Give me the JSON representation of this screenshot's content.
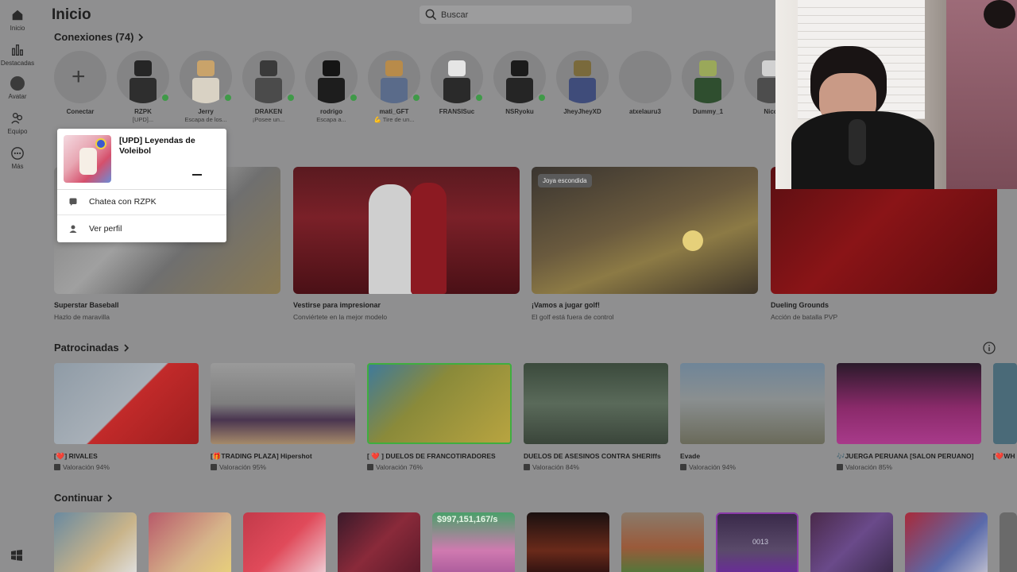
{
  "sidebar": {
    "items": [
      {
        "label": "Inicio",
        "icon": "home-icon"
      },
      {
        "label": "Destacadas",
        "icon": "chart-icon"
      },
      {
        "label": "Avatar",
        "icon": "avatar-icon"
      },
      {
        "label": "Equipo",
        "icon": "team-icon"
      },
      {
        "label": "Más",
        "icon": "more-icon"
      }
    ],
    "bottom_icon": "windows-icon"
  },
  "header": {
    "title": "Inicio",
    "search_placeholder": "Buscar"
  },
  "connections": {
    "title": "Conexiones (74)",
    "items": [
      {
        "name": "Conectar",
        "status": "",
        "online": false
      },
      {
        "name": "RZPK",
        "status": "[UPD]...",
        "online": true
      },
      {
        "name": "Jerry",
        "status": "Escapa de los...",
        "online": true
      },
      {
        "name": "DRAKEN",
        "status": "¡Posee un...",
        "online": true
      },
      {
        "name": "rodrigo",
        "status": "Escapa a...",
        "online": true
      },
      {
        "name": "mati_GFT",
        "status": "💪 Tire de un...",
        "online": true
      },
      {
        "name": "FRANSISuc",
        "status": "",
        "online": false
      },
      {
        "name": "NSRyoku",
        "status": "",
        "online": true
      },
      {
        "name": "JheyJheyXD",
        "status": "",
        "online": false
      },
      {
        "name": "atxelauru3",
        "status": "",
        "online": false
      },
      {
        "name": "Dummy_1",
        "status": "",
        "online": false
      },
      {
        "name": "Nico",
        "status": "",
        "online": false
      }
    ]
  },
  "popup": {
    "game_title": "[UPD] Leyendas de Voleibol",
    "chat_label": "Chatea con RZPK",
    "profile_label": "Ver perfil"
  },
  "recommended": {
    "games": [
      {
        "title": "Superstar Baseball",
        "subtitle": "Hazlo de maravilla",
        "badge": ""
      },
      {
        "title": "Vestirse para impresionar",
        "subtitle": "Conviértete en la mejor modelo",
        "badge": ""
      },
      {
        "title": "¡Vamos a jugar golf!",
        "subtitle": "El golf está fuera de control",
        "badge": "Joya escondida"
      },
      {
        "title": "Dueling Grounds",
        "subtitle": "Acción de batalla PVP",
        "badge": ""
      }
    ]
  },
  "sponsored": {
    "title": "Patrocinadas",
    "games": [
      {
        "title": "[❤️] RIVALES",
        "rating": "Valoración 94%"
      },
      {
        "title": "[🎁TRADING PLAZA] Hipershot",
        "rating": "Valoración 95%"
      },
      {
        "title": "[ ❤️ ] DUELOS DE FRANCOTIRADORES",
        "rating": "Valoración 76%"
      },
      {
        "title": "DUELOS DE ASESINOS CONTRA SHERIffs",
        "rating": "Valoración 84%"
      },
      {
        "title": "Evade",
        "rating": "Valoración 94%"
      },
      {
        "title": "🎶JUERGA PERUANA [SALON PERUANO]",
        "rating": "Valoración 85%"
      },
      {
        "title": "[❤️WH",
        "rating": ""
      }
    ]
  },
  "continue": {
    "title": "Continuar",
    "tiles": [
      "",
      "",
      "",
      "",
      "$997,151,167/s",
      "",
      "",
      "0013",
      "",
      "",
      ""
    ]
  }
}
